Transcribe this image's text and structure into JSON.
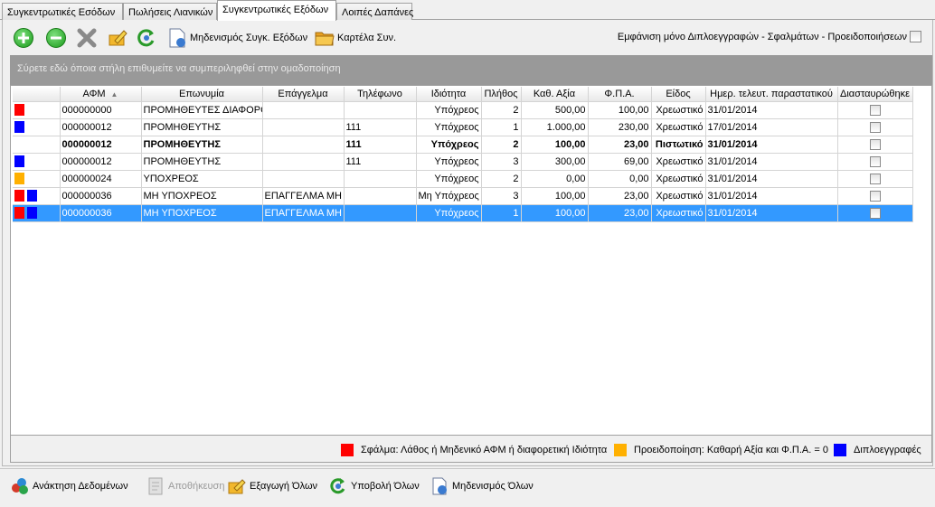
{
  "tabs": [
    {
      "label": "Συγκεντρωτικές Εσόδων",
      "active": false
    },
    {
      "label": "Πωλήσεις Λιανικών",
      "active": false
    },
    {
      "label": "Συγκεντρωτικές Εξόδων",
      "active": true
    },
    {
      "label": "Λοιπές Δαπάνες",
      "active": false
    }
  ],
  "toolbar": {
    "add_icon": "green-plus-icon",
    "remove_icon": "green-minus-icon",
    "delete_icon": "gray-x-icon",
    "edit_icon": "pencil-icon",
    "refresh_icon": "refresh-icon",
    "zero_label": "Μηδενισμός Συγκ. Εξόδων",
    "card_label": "Καρτέλα Συν.",
    "filter_label": "Εμφάνιση μόνο Διπλοεγγραφών - Σφαλμάτων - Προειδοποιήσεων"
  },
  "groupbar": {
    "text": "Σύρετε εδώ όποια στήλη επιθυμείτε να συμπεριληφθεί στην ομαδοποίηση"
  },
  "grid": {
    "columns": [
      "",
      "ΑΦΜ",
      "Επωνυμία",
      "Επάγγελμα",
      "Τηλέφωνο",
      "Ιδιότητα",
      "Πλήθος",
      "Καθ. Αξία",
      "Φ.Π.Α.",
      "Είδος",
      "Ημερ. τελευτ. παραστατικού",
      "Διασταυρώθηκε"
    ],
    "sort_indicator": "▲",
    "rows": [
      {
        "markers": [
          "red"
        ],
        "afm": "000000000",
        "name": "ΠΡΟΜΗΘΕΥΤΕΣ ΔΙΑΦΟΡΟΙ",
        "job": "",
        "phone": "",
        "prop": "Υπόχρεος",
        "count": "2",
        "net": "500,00",
        "vat": "100,00",
        "kind": "Χρεωστικό",
        "date": "31/01/2014",
        "bold": false,
        "selected": false
      },
      {
        "markers": [
          "blue"
        ],
        "afm": "000000012",
        "name": "ΠΡΟΜΗΘΕΥΤΗΣ",
        "job": "",
        "phone": "111",
        "prop": "Υπόχρεος",
        "count": "1",
        "net": "1.000,00",
        "vat": "230,00",
        "kind": "Χρεωστικό",
        "date": "17/01/2014",
        "bold": false,
        "selected": false
      },
      {
        "markers": [],
        "afm": "000000012",
        "name": "ΠΡΟΜΗΘΕΥΤΗΣ",
        "job": "",
        "phone": "111",
        "prop": "Υπόχρεος",
        "count": "2",
        "net": "100,00",
        "vat": "23,00",
        "kind": "Πιστωτικό",
        "date": "31/01/2014",
        "bold": true,
        "selected": false
      },
      {
        "markers": [
          "blue"
        ],
        "afm": "000000012",
        "name": "ΠΡΟΜΗΘΕΥΤΗΣ",
        "job": "",
        "phone": "111",
        "prop": "Υπόχρεος",
        "count": "3",
        "net": "300,00",
        "vat": "69,00",
        "kind": "Χρεωστικό",
        "date": "31/01/2014",
        "bold": false,
        "selected": false
      },
      {
        "markers": [
          "orange"
        ],
        "afm": "000000024",
        "name": "ΥΠΟΧΡΕΟΣ",
        "job": "",
        "phone": "",
        "prop": "Υπόχρεος",
        "count": "2",
        "net": "0,00",
        "vat": "0,00",
        "kind": "Χρεωστικό",
        "date": "31/01/2014",
        "bold": false,
        "selected": false
      },
      {
        "markers": [
          "red",
          "blue"
        ],
        "afm": "000000036",
        "name": "ΜΗ ΥΠΟΧΡΕΟΣ",
        "job": "ΕΠΑΓΓΕΛΜΑ ΜΗ Υ",
        "phone": "",
        "prop": "Μη Υπόχρεος",
        "count": "3",
        "net": "100,00",
        "vat": "23,00",
        "kind": "Χρεωστικό",
        "date": "31/01/2014",
        "bold": false,
        "selected": false
      },
      {
        "markers": [
          "red",
          "blue"
        ],
        "afm": "000000036",
        "name": "ΜΗ ΥΠΟΧΡΕΟΣ",
        "job": "ΕΠΑΓΓΕΛΜΑ ΜΗ Υ",
        "phone": "",
        "prop": "Υπόχρεος",
        "count": "1",
        "net": "100,00",
        "vat": "23,00",
        "kind": "Χρεωστικό",
        "date": "31/01/2014",
        "bold": false,
        "selected": true
      }
    ]
  },
  "legend": {
    "error": {
      "color": "#ff0000",
      "label": "Σφάλμα: Λάθος ή Μηδενικό ΑΦΜ ή διαφορετική Ιδιότητα"
    },
    "warning": {
      "color": "#ffb000",
      "label": "Προειδοποίηση: Καθαρή Αξία και Φ.Π.Α. = 0"
    },
    "duplicate": {
      "color": "#0000ff",
      "label": "Διπλοεγγραφές"
    }
  },
  "bottombar": {
    "fetch_label": "Ανάκτηση Δεδομένων",
    "save_label": "Αποθήκευση",
    "export_label": "Εξαγωγή Όλων",
    "submit_label": "Υποβολή Όλων",
    "zero_all_label": "Μηδενισμός Όλων"
  }
}
